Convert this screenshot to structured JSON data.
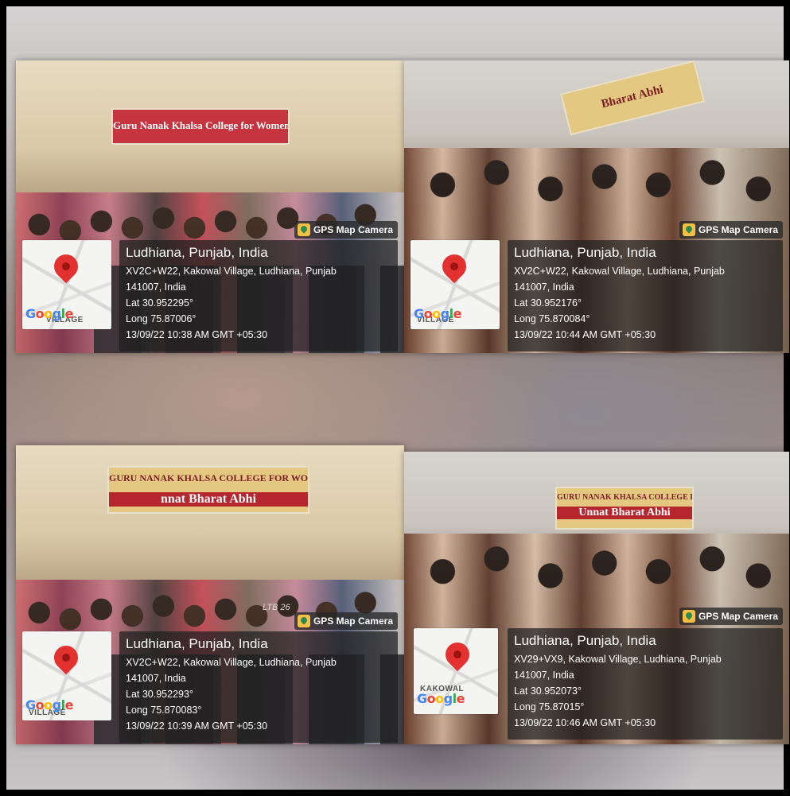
{
  "photos": [
    {
      "id": "p1",
      "banner_line1": "Guru Nanak Khalsa College for Women",
      "banner_line2": "",
      "desk_label": "",
      "gps_label": "GPS Map Camera",
      "city": "Ludhiana, Punjab, India",
      "address": "XV2C+W22, Kakowal Village, Ludhiana, Punjab",
      "postal": "141007, India",
      "lat": "Lat 30.952295°",
      "long": "Long 75.87006°",
      "datetime": "13/09/22 10:38 AM GMT +05:30",
      "map_village": "VILLAGE",
      "map_brand": "Google"
    },
    {
      "id": "p2",
      "banner_line1": "",
      "banner_line2": "Bharat Abhi",
      "desk_label": "",
      "gps_label": "GPS Map Camera",
      "city": "Ludhiana, Punjab, India",
      "address": "XV2C+W22, Kakowal Village, Ludhiana, Punjab",
      "postal": "141007, India",
      "lat": "Lat 30.952176°",
      "long": "Long 75.870084°",
      "datetime": "13/09/22 10:44 AM GMT +05:30",
      "map_village": "VILLAGE",
      "map_brand": "Google"
    },
    {
      "id": "p3",
      "banner_line1": "GURU NANAK KHALSA COLLEGE FOR WOMEN",
      "banner_line2": "nnat Bharat Abhi",
      "desk_label": "LTB 26",
      "gps_label": "GPS Map Camera",
      "city": "Ludhiana, Punjab, India",
      "address": "XV2C+W22, Kakowal Village, Ludhiana, Punjab",
      "postal": "141007, India",
      "lat": "Lat 30.952293°",
      "long": "Long 75.870083°",
      "datetime": "13/09/22 10:39 AM GMT +05:30",
      "map_village": "VILLAGE",
      "map_brand": "Google"
    },
    {
      "id": "p4",
      "banner_line1": "GURU NANAK KHALSA COLLEGE FOR WOMEN",
      "banner_line2": "Unnat Bharat Abhi",
      "desk_label": "",
      "gps_label": "GPS Map Camera",
      "city": "Ludhiana, Punjab, India",
      "address": "XV29+VX9, Kakowal Village, Ludhiana, Punjab",
      "postal": "141007, India",
      "lat": "Lat 30.952073°",
      "long": "Long 75.87015°",
      "datetime": "13/09/22 10:46 AM GMT +05:30",
      "map_village": "KAKOWAL",
      "map_brand": "Google"
    }
  ],
  "colors": {
    "pin": "#e3312f",
    "overlay": "#1e1e1e",
    "gps_icon": "#f6c044"
  },
  "icons": [
    "map-pin-icon",
    "gps-camera-icon"
  ]
}
